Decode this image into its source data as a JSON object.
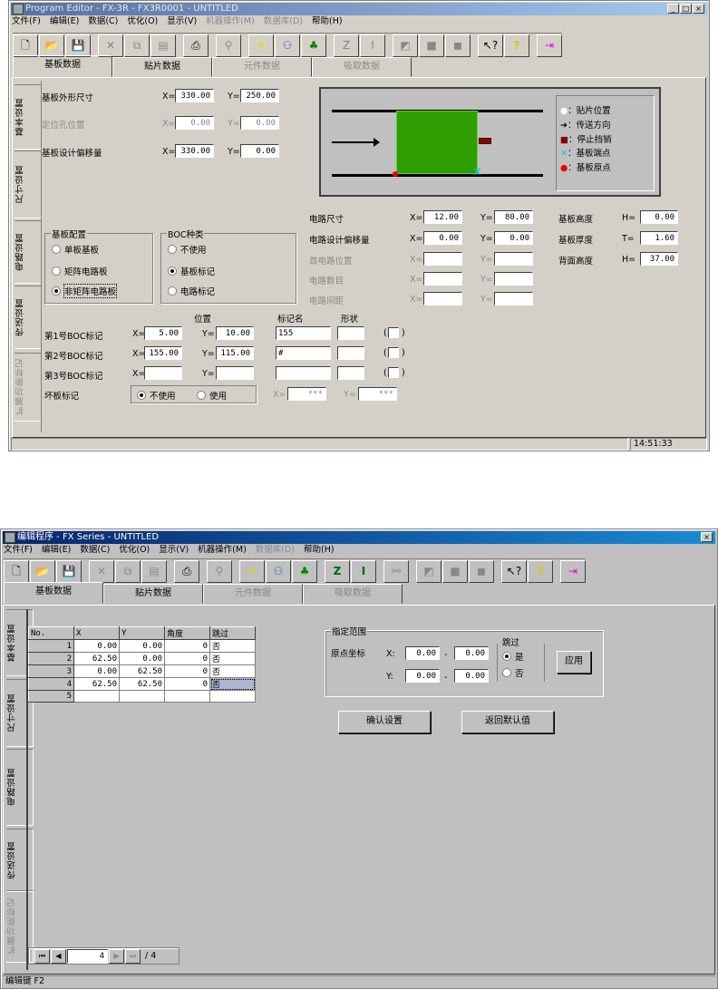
{
  "window1": {
    "title": "Program Editor - FX-3R - FX3R0001 - UNTITLED",
    "menu": [
      "文件(F)",
      "编辑(E)",
      "数据(C)",
      "优化(O)",
      "显示(V)",
      "机器操作(M)",
      "数据库(D)",
      "帮助(H)"
    ],
    "tabs": [
      "基板数据",
      "贴片数据",
      "元件数据",
      "吸取数据"
    ],
    "side_tabs": [
      "基本设置",
      "尺寸设置",
      "电路设置",
      "传送设置",
      "扩展功能标记"
    ],
    "board_size": {
      "label": "基板外形尺寸",
      "x_label": "X=",
      "x": "330.00",
      "y_label": "Y=",
      "y": "250.00"
    },
    "hole_pos": {
      "label": "定位孔位置",
      "x_label": "X=",
      "x": "0.00",
      "y_label": "Y=",
      "y": "0.00"
    },
    "board_offset": {
      "label": "基板设计偏移量",
      "x_label": "X=",
      "x": "330.00",
      "y_label": "Y=",
      "y": "0.00"
    },
    "legend": [
      "：贴片位置",
      "：传送方向",
      "：停止挡销",
      "：基板端点",
      "：基板原点"
    ],
    "board_config": {
      "title": "基板配置",
      "options": [
        "单板基板",
        "矩阵电路板",
        "非矩阵电路板"
      ],
      "selected": 2
    },
    "boc_type": {
      "title": "BOC种类",
      "options": [
        "不使用",
        "基板标记",
        "电路标记"
      ],
      "selected": 1
    },
    "circuit": [
      {
        "label": "电路尺寸",
        "x_label": "X=",
        "x": "12.00",
        "y_label": "Y=",
        "y": "80.00",
        "disabled": false
      },
      {
        "label": "电路设计偏移量",
        "x_label": "X=",
        "x": "0.00",
        "y_label": "Y=",
        "y": "0.00",
        "disabled": false
      },
      {
        "label": "首电路位置",
        "x_label": "X=",
        "x": "",
        "y_label": "Y=",
        "y": "",
        "disabled": true
      },
      {
        "label": "电路数目",
        "x_label": "X=",
        "x": "",
        "y_label": "Y=",
        "y": "",
        "disabled": true
      },
      {
        "label": "电路间距",
        "x_label": "X=",
        "x": "",
        "y_label": "Y=",
        "y": "",
        "disabled": true
      }
    ],
    "heights": [
      {
        "label": "基板高度",
        "unit": "H=",
        "value": "0.00"
      },
      {
        "label": "基板厚度",
        "unit": "T=",
        "value": "1.60"
      },
      {
        "label": "背面高度",
        "unit": "H=",
        "value": "37.00"
      }
    ],
    "boc_headers": {
      "position": "位置",
      "mark_name": "标记名",
      "shape": "形状"
    },
    "boc_marks": [
      {
        "label": "第1号BOC标记",
        "x_label": "X=",
        "x": "5.00",
        "y_label": "Y=",
        "y": "10.00",
        "name": "155",
        "shape": ""
      },
      {
        "label": "第2号BOC标记",
        "x_label": "X=",
        "x": "155.00",
        "y_label": "Y=",
        "y": "115.00",
        "name": "#",
        "shape": ""
      },
      {
        "label": "第3号BOC标记",
        "x_label": "X=",
        "x": "",
        "y_label": "Y=",
        "y": "",
        "name": "",
        "shape": ""
      }
    ],
    "bad_mark": {
      "label": "坏板标记",
      "options": [
        "不使用",
        "使用"
      ],
      "selected": 0,
      "x_label": "X=",
      "x": "***",
      "y_label": "Y=",
      "y": "***"
    },
    "status_time": "14:51:33"
  },
  "window2": {
    "title": "编辑程序 - FX Series - UNTITLED",
    "menu": [
      "文件(F)",
      "编辑(E)",
      "数据(C)",
      "优化(O)",
      "显示(V)",
      "机器操作(M)",
      "数据库(D)",
      "帮助(H)"
    ],
    "tabs": [
      "基板数据",
      "贴片数据",
      "元件数据",
      "吸取数据"
    ],
    "side_tabs": [
      "基本设置",
      "尺寸设置",
      "电路设置",
      "传送设置",
      "扩展功能标记"
    ],
    "table": {
      "headers": [
        "No.",
        "X",
        "Y",
        "角度",
        "跳过"
      ],
      "rows": [
        [
          "1",
          "0.00",
          "0.00",
          "0",
          "否"
        ],
        [
          "2",
          "62.50",
          "0.00",
          "0",
          "否"
        ],
        [
          "3",
          "0.00",
          "62.50",
          "0",
          "否"
        ],
        [
          "4",
          "62.50",
          "62.50",
          "0",
          "否"
        ],
        [
          "5",
          "",
          "",
          "",
          ""
        ]
      ]
    },
    "range": {
      "title": "指定范围",
      "origin_label": "原点坐标",
      "x_label": "X:",
      "x_from": "0.00",
      "x_to": "0.00",
      "y_label": "Y:",
      "y_from": "0.00",
      "y_to": "0.00",
      "dash": "-",
      "skip_label": "跳过",
      "skip_options": [
        "是",
        "否"
      ],
      "skip_selected": 0,
      "apply": "应用"
    },
    "confirm": "确认设置",
    "reset": "返回默认值",
    "navigator": {
      "current": "4",
      "total": "/ 4"
    },
    "status": "编辑键 F2"
  }
}
